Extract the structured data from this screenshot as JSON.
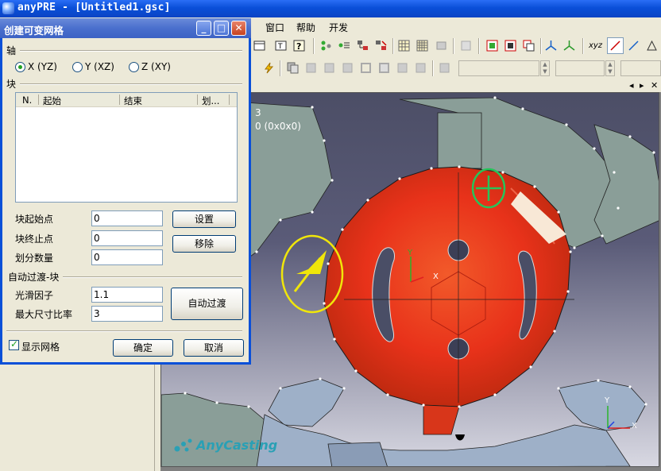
{
  "window": {
    "title": "anyPRE - [Untitled1.gsc]"
  },
  "menu": {
    "items": [
      "窗口",
      "帮助",
      "开发"
    ]
  },
  "toolbar": {
    "axis_label": "xyz"
  },
  "viewport": {
    "info_line1": "3",
    "info_line2": "0 (0x0x0)",
    "axis_y": "Y",
    "axis_x": "X",
    "corner_axis_y": "Y",
    "corner_axis_x": "X",
    "watermark": "AnyCasting"
  },
  "dialog": {
    "title": "创建可变网格",
    "axis_group": "轴",
    "axis_options": [
      {
        "label": "X (YZ)",
        "selected": true
      },
      {
        "label": "Y (XZ)",
        "selected": false
      },
      {
        "label": "Z (XY)",
        "selected": false
      }
    ],
    "block_group": "块",
    "list_columns": [
      "N.",
      "起始",
      "结束",
      "划..."
    ],
    "block_start_label": "块起始点",
    "block_start_value": "0",
    "block_end_label": "块终止点",
    "block_end_value": "0",
    "divisions_label": "划分数量",
    "divisions_value": "0",
    "set_button": "设置",
    "remove_button": "移除",
    "auto_group": "自动过渡-块",
    "smooth_label": "光滑因子",
    "smooth_value": "1.1",
    "max_ratio_label": "最大尺寸比率",
    "max_ratio_value": "3",
    "auto_button": "自动过渡",
    "show_grid_label": "显示网格",
    "show_grid_checked": true,
    "ok_button": "确定",
    "cancel_button": "取消"
  },
  "colors": {
    "titlebar": "#0a4fd8",
    "dialog_titlebar": "#4a6fcd",
    "part_red": "#e8321a",
    "mold_grey": "#8a9e98",
    "runner_blue": "#9eb0c8",
    "highlight_yellow": "#f0e60a",
    "highlight_green": "#27c45a"
  }
}
